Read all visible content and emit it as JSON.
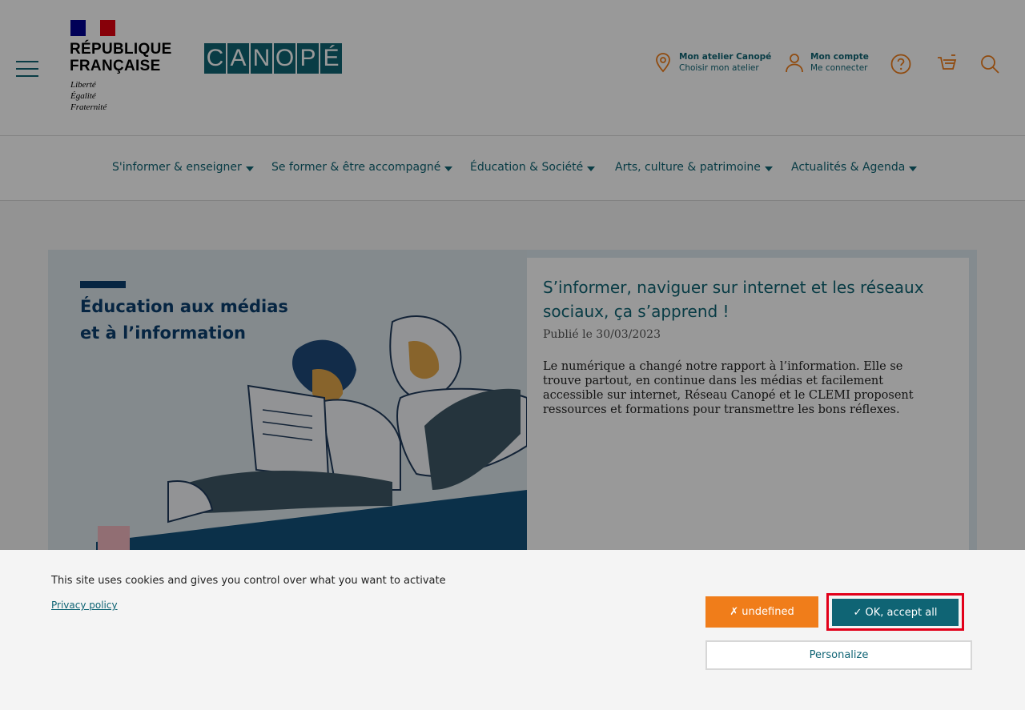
{
  "header": {
    "republic": {
      "name_line1": "RÉPUBLIQUE",
      "name_line2": "FRANÇAISE",
      "motto": [
        "Liberté",
        "Égalité",
        "Fraternité"
      ]
    },
    "brand_letters": [
      "C",
      "A",
      "N",
      "O",
      "P",
      "É"
    ],
    "atelier": {
      "title": "Mon atelier Canopé",
      "subtitle": "Choisir mon atelier"
    },
    "account": {
      "title": "Mon compte",
      "subtitle": "Me connecter"
    },
    "icons": [
      "menu-icon",
      "location-pin-icon",
      "user-icon",
      "help-icon",
      "cart-icon",
      "search-icon"
    ]
  },
  "nav": {
    "items": [
      {
        "label": "S'informer & enseigner"
      },
      {
        "label": "Se former & être accompagné"
      },
      {
        "label": "Éducation & Société"
      },
      {
        "label": "Arts, culture & patrimoine"
      },
      {
        "label": "Actualités & Agenda"
      }
    ]
  },
  "feature": {
    "hero_title_line1": "Éducation aux médias",
    "hero_title_line2": "et à l’information",
    "title": "S’informer, naviguer sur internet et les réseaux sociaux, ça s’apprend !",
    "date": "Publié le 30/03/2023",
    "description": "Le numérique a changé notre rapport à l’information. Elle se trouve partout, en continue dans les médias et facilement accessible sur internet, Réseau Canopé et le CLEMI proposent ressources et formations pour transmettre les bons réflexes."
  },
  "cookie": {
    "message": "This site uses cookies and gives you control over what you want to activate",
    "privacy_link": "Privacy policy",
    "deny_label": "✗ undefined",
    "accept_label": "✓ OK, accept all",
    "personalize_label": "Personalize"
  },
  "colors": {
    "brand_teal": "#0f6474",
    "deny_orange": "#f07d1a",
    "highlight_red": "#e2001a",
    "navy": "#0b3f6e"
  }
}
